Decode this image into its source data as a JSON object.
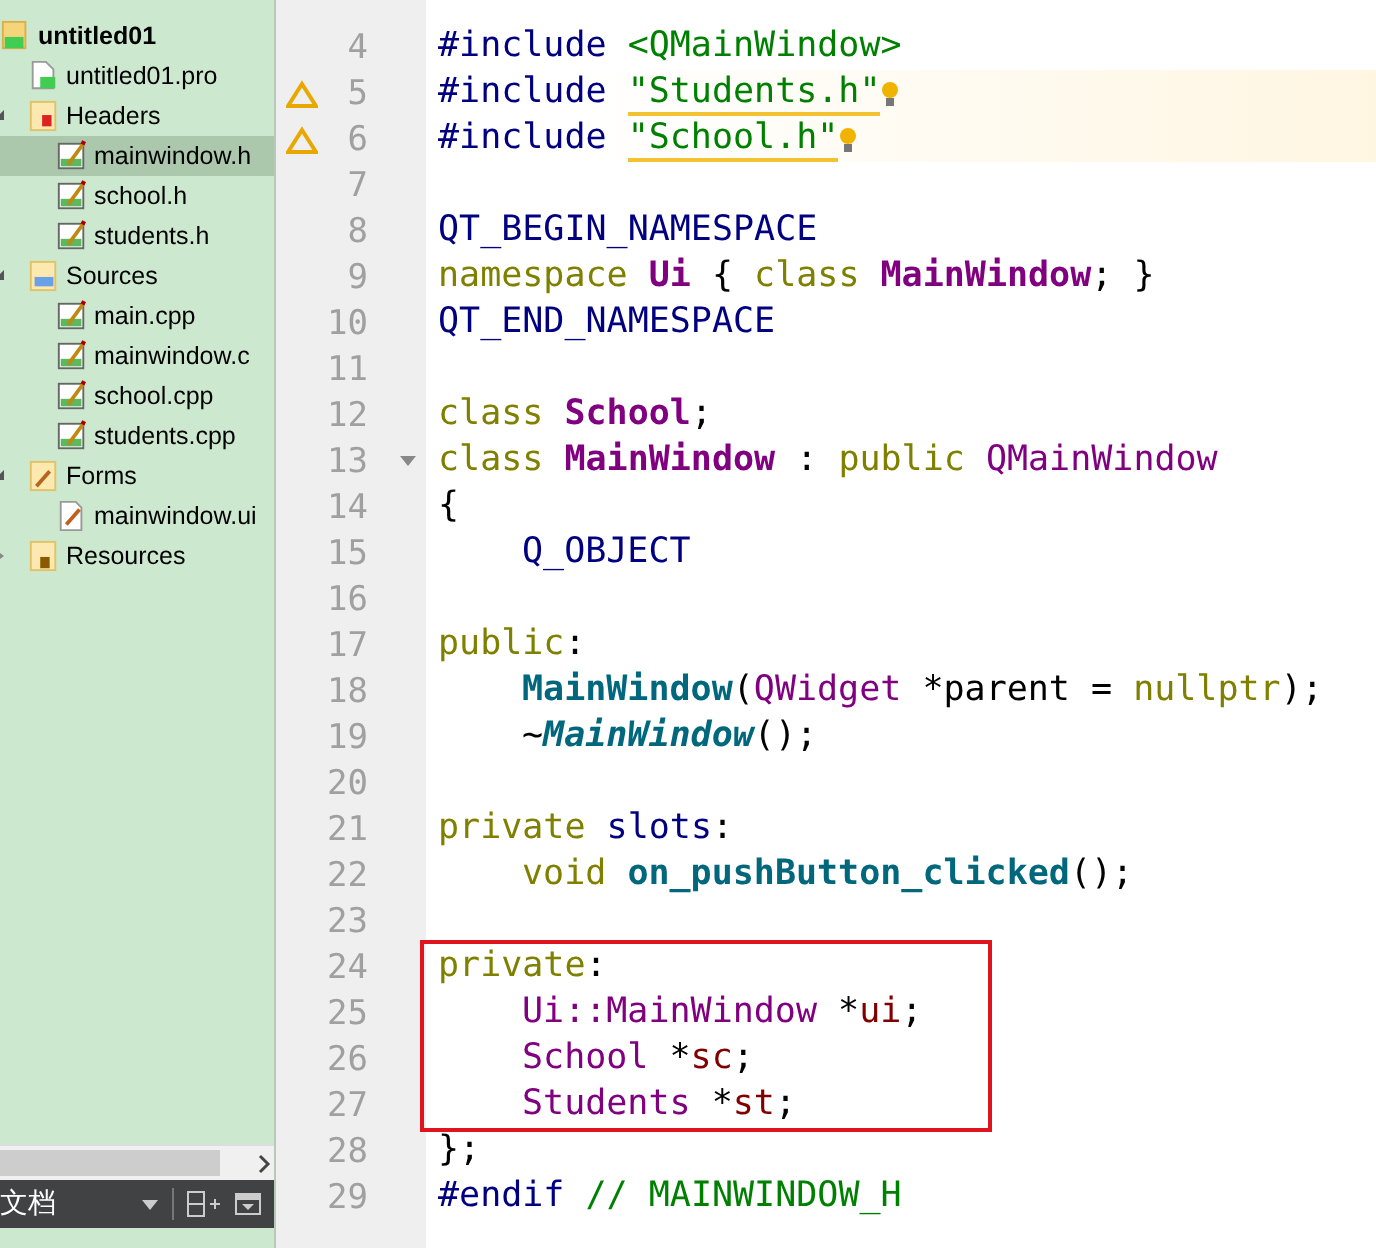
{
  "project_tree": [
    {
      "label": "untitled01",
      "kind": "project",
      "active": true,
      "selected": false,
      "children": [
        {
          "label": "untitled01.pro",
          "kind": "pro",
          "selected": false
        },
        {
          "label": "Headers",
          "kind": "headers",
          "expanded": true,
          "selected": false,
          "children": [
            {
              "label": "mainwindow.h",
              "kind": "source",
              "selected": true
            },
            {
              "label": "school.h",
              "kind": "source",
              "selected": false
            },
            {
              "label": "students.h",
              "kind": "source",
              "selected": false
            }
          ]
        },
        {
          "label": "Sources",
          "kind": "sources",
          "expanded": true,
          "selected": false,
          "children": [
            {
              "label": "main.cpp",
              "kind": "source",
              "selected": false
            },
            {
              "label": "mainwindow.c",
              "kind": "source",
              "selected": false
            },
            {
              "label": "school.cpp",
              "kind": "source",
              "selected": false
            },
            {
              "label": "students.cpp",
              "kind": "source",
              "selected": false
            }
          ]
        },
        {
          "label": "Forms",
          "kind": "forms",
          "expanded": true,
          "selected": false,
          "children": [
            {
              "label": "mainwindow.ui",
              "kind": "form",
              "selected": false
            }
          ]
        },
        {
          "label": "Resources",
          "kind": "resources",
          "expanded": false,
          "selected": false
        }
      ]
    }
  ],
  "documents_bar": {
    "title": "文档"
  },
  "editor": {
    "lines": [
      {
        "number": "4",
        "tokens": [
          {
            "text": "#include ",
            "kind": "preproc"
          },
          {
            "text": "<QMainWindow>",
            "kind": "include"
          }
        ]
      },
      {
        "number": "5",
        "warning": true,
        "tokens": [
          {
            "text": "#include ",
            "kind": "preproc"
          },
          {
            "text": "\"Students.h\"",
            "kind": "include"
          }
        ]
      },
      {
        "number": "6",
        "warning": true,
        "tokens": [
          {
            "text": "#include ",
            "kind": "preproc"
          },
          {
            "text": "\"School.h\"",
            "kind": "include"
          }
        ]
      },
      {
        "number": "7"
      },
      {
        "number": "8",
        "tokens": [
          {
            "text": "QT_BEGIN_NAMESPACE",
            "kind": "macro"
          }
        ]
      },
      {
        "number": "9",
        "tokens": [
          {
            "text": "namespace ",
            "kind": "keyword"
          },
          {
            "text": "Ui",
            "kind": "type-decl"
          },
          {
            "text": " { ",
            "kind": "plain"
          },
          {
            "text": "class ",
            "kind": "keyword"
          },
          {
            "text": "MainWindow",
            "kind": "type-decl"
          },
          {
            "text": "; }",
            "kind": "plain"
          }
        ]
      },
      {
        "number": "10",
        "tokens": [
          {
            "text": "QT_END_NAMESPACE",
            "kind": "macro"
          }
        ]
      },
      {
        "number": "11"
      },
      {
        "number": "12",
        "tokens": [
          {
            "text": "class ",
            "kind": "keyword"
          },
          {
            "text": "School",
            "kind": "type-decl"
          },
          {
            "text": ";",
            "kind": "plain"
          }
        ]
      },
      {
        "number": "13",
        "foldable": true,
        "tokens": [
          {
            "text": "class ",
            "kind": "keyword"
          },
          {
            "text": "MainWindow",
            "kind": "type-decl"
          },
          {
            "text": " : ",
            "kind": "plain"
          },
          {
            "text": "public ",
            "kind": "keyword"
          },
          {
            "text": "QMainWindow",
            "kind": "type"
          }
        ]
      },
      {
        "number": "14",
        "tokens": [
          {
            "text": "{",
            "kind": "plain"
          }
        ]
      },
      {
        "number": "15",
        "indented": true,
        "tokens": [
          {
            "text": "Q_OBJECT",
            "kind": "macro"
          }
        ]
      },
      {
        "number": "16"
      },
      {
        "number": "17",
        "tokens": [
          {
            "text": "public",
            "kind": "keyword"
          },
          {
            "text": ":",
            "kind": "plain"
          }
        ]
      },
      {
        "number": "18",
        "indented": true,
        "tokens": [
          {
            "text": "MainWindow",
            "kind": "function-decl"
          },
          {
            "text": "(",
            "kind": "plain"
          },
          {
            "text": "QWidget",
            "kind": "type"
          },
          {
            "text": " *parent = ",
            "kind": "plain"
          },
          {
            "text": "nullptr",
            "kind": "keyword"
          },
          {
            "text": ");",
            "kind": "plain"
          }
        ]
      },
      {
        "number": "19",
        "indented": true,
        "tokens": [
          {
            "text": "~",
            "kind": "plain"
          },
          {
            "text": "MainWindow",
            "kind": "virtual-decl"
          },
          {
            "text": "();",
            "kind": "plain"
          }
        ]
      },
      {
        "number": "20"
      },
      {
        "number": "21",
        "tokens": [
          {
            "text": "private ",
            "kind": "keyword"
          },
          {
            "text": "slots",
            "kind": "macro"
          },
          {
            "text": ":",
            "kind": "plain"
          }
        ]
      },
      {
        "number": "22",
        "indented": true,
        "tokens": [
          {
            "text": "void ",
            "kind": "keyword"
          },
          {
            "text": "on_pushButton_clicked",
            "kind": "function-decl"
          },
          {
            "text": "();",
            "kind": "plain"
          }
        ]
      },
      {
        "number": "23"
      },
      {
        "number": "24",
        "boxed": true,
        "tokens": [
          {
            "text": "private",
            "kind": "keyword"
          },
          {
            "text": ":",
            "kind": "plain"
          }
        ]
      },
      {
        "number": "25",
        "boxed": true,
        "indented": true,
        "tokens": [
          {
            "text": "Ui::MainWindow",
            "kind": "type"
          },
          {
            "text": " *",
            "kind": "plain"
          },
          {
            "text": "ui",
            "kind": "field"
          },
          {
            "text": ";",
            "kind": "plain"
          }
        ]
      },
      {
        "number": "26",
        "boxed": true,
        "indented": true,
        "tokens": [
          {
            "text": "School",
            "kind": "type"
          },
          {
            "text": " *",
            "kind": "plain"
          },
          {
            "text": "sc",
            "kind": "field"
          },
          {
            "text": ";",
            "kind": "plain"
          }
        ]
      },
      {
        "number": "27",
        "boxed": true,
        "indented": true,
        "tokens": [
          {
            "text": "Students",
            "kind": "type"
          },
          {
            "text": " *",
            "kind": "plain"
          },
          {
            "text": "st",
            "kind": "field"
          },
          {
            "text": ";",
            "kind": "plain"
          }
        ]
      },
      {
        "number": "28",
        "tokens": [
          {
            "text": "};",
            "kind": "plain"
          }
        ]
      },
      {
        "number": "29",
        "tokens": [
          {
            "text": "#endif ",
            "kind": "preproc"
          },
          {
            "text": "// MAINWINDOW_H",
            "kind": "include"
          }
        ]
      }
    ]
  }
}
